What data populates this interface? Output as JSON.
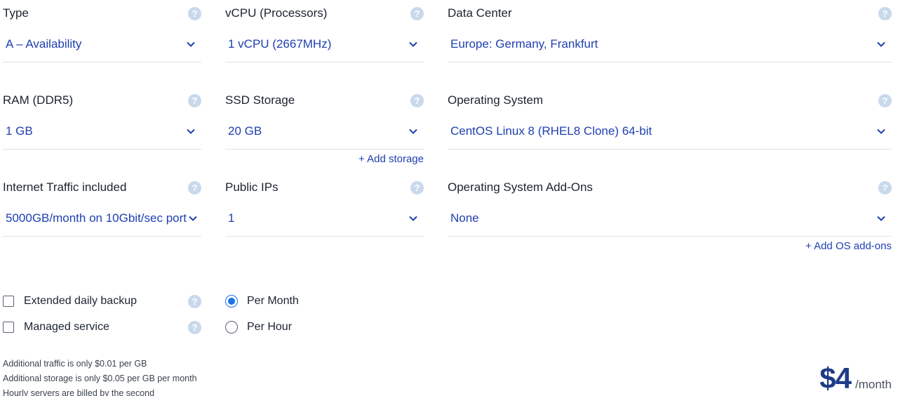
{
  "fields": {
    "type": {
      "label": "Type",
      "value": "A – Availability"
    },
    "vcpu": {
      "label": "vCPU (Processors)",
      "value": "1 vCPU (2667MHz)"
    },
    "datacenter": {
      "label": "Data Center",
      "value": "Europe: Germany, Frankfurt"
    },
    "ram": {
      "label": "RAM (DDR5)",
      "value": "1 GB"
    },
    "ssd": {
      "label": "SSD Storage",
      "value": "20 GB",
      "add_label": "+ Add storage"
    },
    "os": {
      "label": "Operating System",
      "value": "CentOS Linux 8 (RHEL8 Clone) 64-bit"
    },
    "traffic": {
      "label": "Internet Traffic included",
      "value": "5000GB/month on 10Gbit/sec port"
    },
    "ips": {
      "label": "Public IPs",
      "value": "1"
    },
    "os_addons": {
      "label": "Operating System Add-Ons",
      "value": "None",
      "add_label": "+ Add OS add-ons"
    }
  },
  "help_icon": "question-circle-icon",
  "help_glyph": "?",
  "options": {
    "backup": {
      "label": "Extended daily backup",
      "checked": false
    },
    "managed": {
      "label": "Managed service",
      "checked": false
    }
  },
  "billing": {
    "per_month": {
      "label": "Per Month",
      "selected": true
    },
    "per_hour": {
      "label": "Per Hour",
      "selected": false
    }
  },
  "notes": [
    "Additional traffic is only $0.01 per GB",
    "Additional storage is only $0.05 per GB per month",
    "Hourly servers are billed by the second"
  ],
  "price": {
    "amount": "$4",
    "unit": "/month"
  },
  "colors": {
    "accent": "#1e3fb0",
    "radio": "#1a73e8",
    "help": "#c9d9ec",
    "price": "#1d3b86"
  }
}
